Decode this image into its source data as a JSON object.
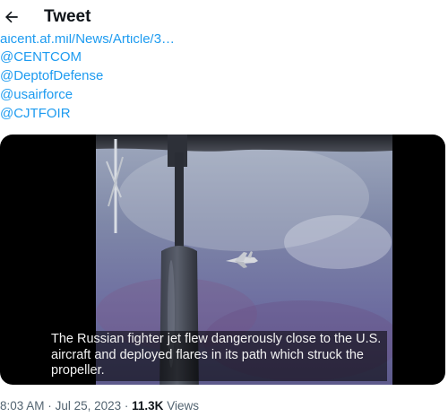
{
  "header": {
    "title": "Tweet",
    "back_icon": "arrow-left-icon"
  },
  "tweet": {
    "links": [
      "aicent.af.mil/News/Article/3…",
      "@CENTCOM",
      "@DeptofDefense",
      "@usairforce",
      "@CJTFOIR"
    ],
    "video_caption": "The Russian fighter jet flew dangerously close to the U.S. aircraft and deployed flares in its path which struck the propeller.",
    "time": "8:03 AM",
    "date": "Jul 25, 2023",
    "separator": "·",
    "views_count": "11.3K",
    "views_label": "Views"
  },
  "colors": {
    "link": "#1d9bf0",
    "text": "#0f1419",
    "muted": "#536471"
  }
}
